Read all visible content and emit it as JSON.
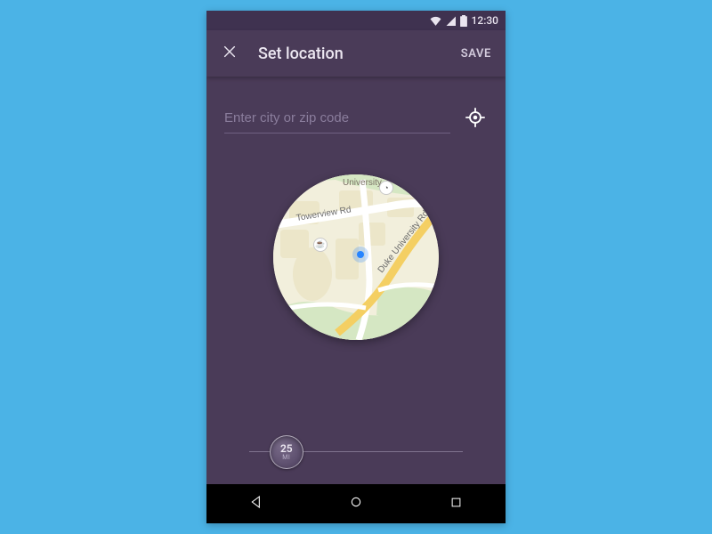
{
  "statusbar": {
    "time": "12:30"
  },
  "appbar": {
    "title": "Set location",
    "save_label": "SAVE"
  },
  "search": {
    "placeholder": "Enter city or zip code",
    "value": ""
  },
  "map": {
    "road_labels": [
      "Towerview Rd",
      "Duke University Rd"
    ],
    "poi_labels": [
      "University"
    ],
    "user_location_visible": true
  },
  "slider": {
    "value": "25",
    "unit": "MI",
    "percent": 17
  }
}
